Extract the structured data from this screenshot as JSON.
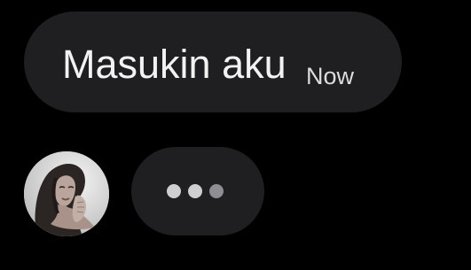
{
  "conversation": {
    "outgoing_message": {
      "text": "Masukin aku",
      "timestamp": "Now"
    },
    "incoming": {
      "avatar_icon": "contact-avatar-photo",
      "typing_indicator": {
        "dot_count": 3,
        "dot_colors": [
          "#cfcfd1",
          "#cfcfd1",
          "#8e8e93"
        ]
      }
    },
    "colors": {
      "background": "#000000",
      "bubble": "#1f1f21",
      "text": "#f2f2f2"
    }
  }
}
